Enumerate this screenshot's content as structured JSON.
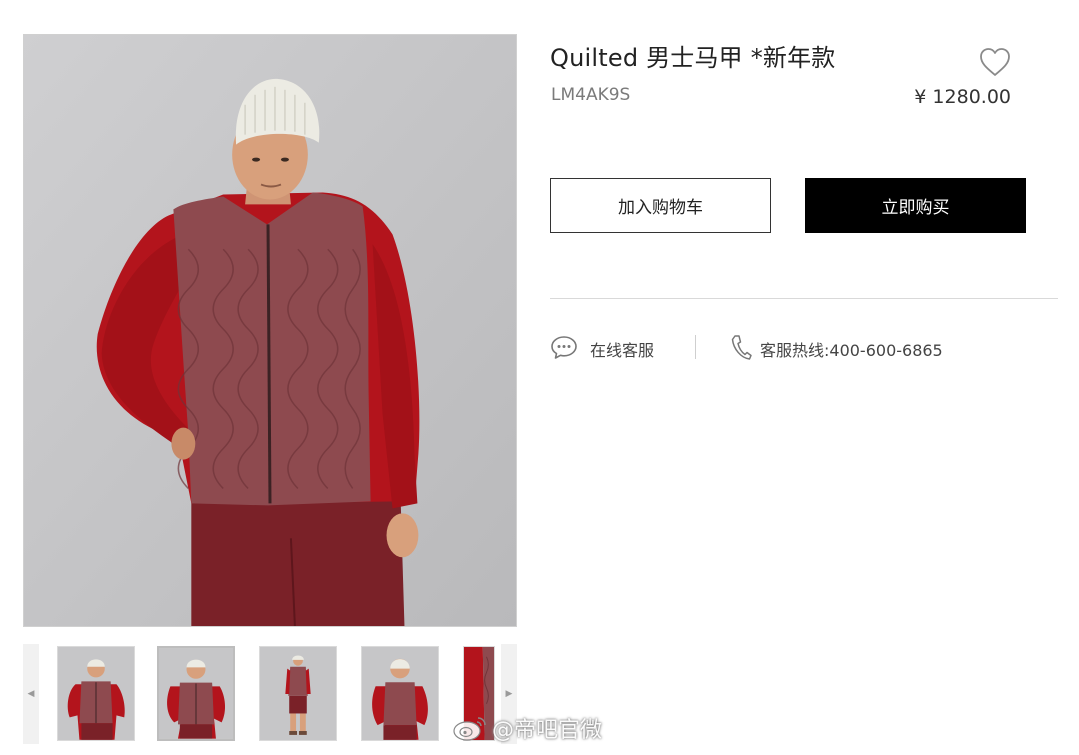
{
  "product": {
    "title": "Quilted 男士马甲 *新年款",
    "sku": "LM4AK9S",
    "price": "¥ 1280.00"
  },
  "actions": {
    "add_to_cart": "加入购物车",
    "buy_now": "立即购买"
  },
  "service": {
    "chat_label": "在线客服",
    "hotline_label": "客服热线:400-600-6865"
  },
  "gallery": {
    "thumbnails": [
      "front view",
      "front view close",
      "full body",
      "side view",
      "back detail"
    ]
  },
  "watermark": "@帝吧官微",
  "colors": {
    "vest": "#8e4a4f",
    "sweater": "#b3141c",
    "pants": "#7a2128",
    "background": "#c6c6c8",
    "buy_button": "#000000"
  },
  "icons": [
    "heart-icon",
    "chat-bubble-icon",
    "phone-icon",
    "chevron-left-icon",
    "chevron-right-icon",
    "weibo-icon"
  ]
}
